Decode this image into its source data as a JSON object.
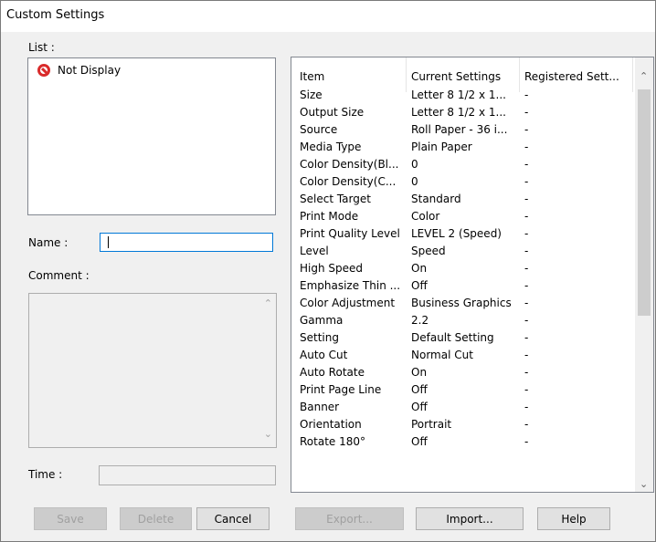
{
  "window": {
    "title": "Custom Settings"
  },
  "labels": {
    "list": "List :",
    "name": "Name :",
    "comment": "Comment :",
    "time": "Time :"
  },
  "list": {
    "items": [
      {
        "label": "Not Display",
        "icon": "prohibited-icon"
      }
    ]
  },
  "name_field": {
    "value": ""
  },
  "comment_field": {
    "value": ""
  },
  "time_field": {
    "value": ""
  },
  "table": {
    "headers": [
      "Item",
      "Current Settings",
      "Registered Sett..."
    ],
    "rows": [
      [
        "Size",
        "Letter 8 1/2 x 1...",
        "-"
      ],
      [
        "Output Size",
        "Letter 8 1/2 x 1...",
        "-"
      ],
      [
        "Source",
        "Roll Paper - 36 i...",
        "-"
      ],
      [
        "Media Type",
        "Plain Paper",
        "-"
      ],
      [
        "Color Density(Bl...",
        "0",
        "-"
      ],
      [
        "Color Density(C...",
        "0",
        "-"
      ],
      [
        "Select Target",
        "Standard",
        "-"
      ],
      [
        "Print Mode",
        "Color",
        "-"
      ],
      [
        "Print Quality Level",
        "LEVEL 2 (Speed)",
        "-"
      ],
      [
        "Level",
        "Speed",
        "-"
      ],
      [
        "High Speed",
        "On",
        "-"
      ],
      [
        "Emphasize Thin ...",
        "Off",
        "-"
      ],
      [
        "Color Adjustment",
        "Business Graphics",
        "-"
      ],
      [
        "Gamma",
        "2.2",
        "-"
      ],
      [
        "Setting",
        "Default Setting",
        "-"
      ],
      [
        "Auto Cut",
        "Normal Cut",
        "-"
      ],
      [
        "Auto Rotate",
        "On",
        "-"
      ],
      [
        "Print Page Line",
        "Off",
        "-"
      ],
      [
        "Banner",
        "Off",
        "-"
      ],
      [
        "Orientation",
        "Portrait",
        "-"
      ],
      [
        "Rotate 180°",
        "Off",
        "-"
      ]
    ]
  },
  "buttons": {
    "save": "Save",
    "delete": "Delete",
    "cancel": "Cancel",
    "export": "Export...",
    "import": "Import...",
    "help": "Help"
  },
  "colors": {
    "accent": "#0078d7",
    "prohibited": "#d92b2b"
  }
}
